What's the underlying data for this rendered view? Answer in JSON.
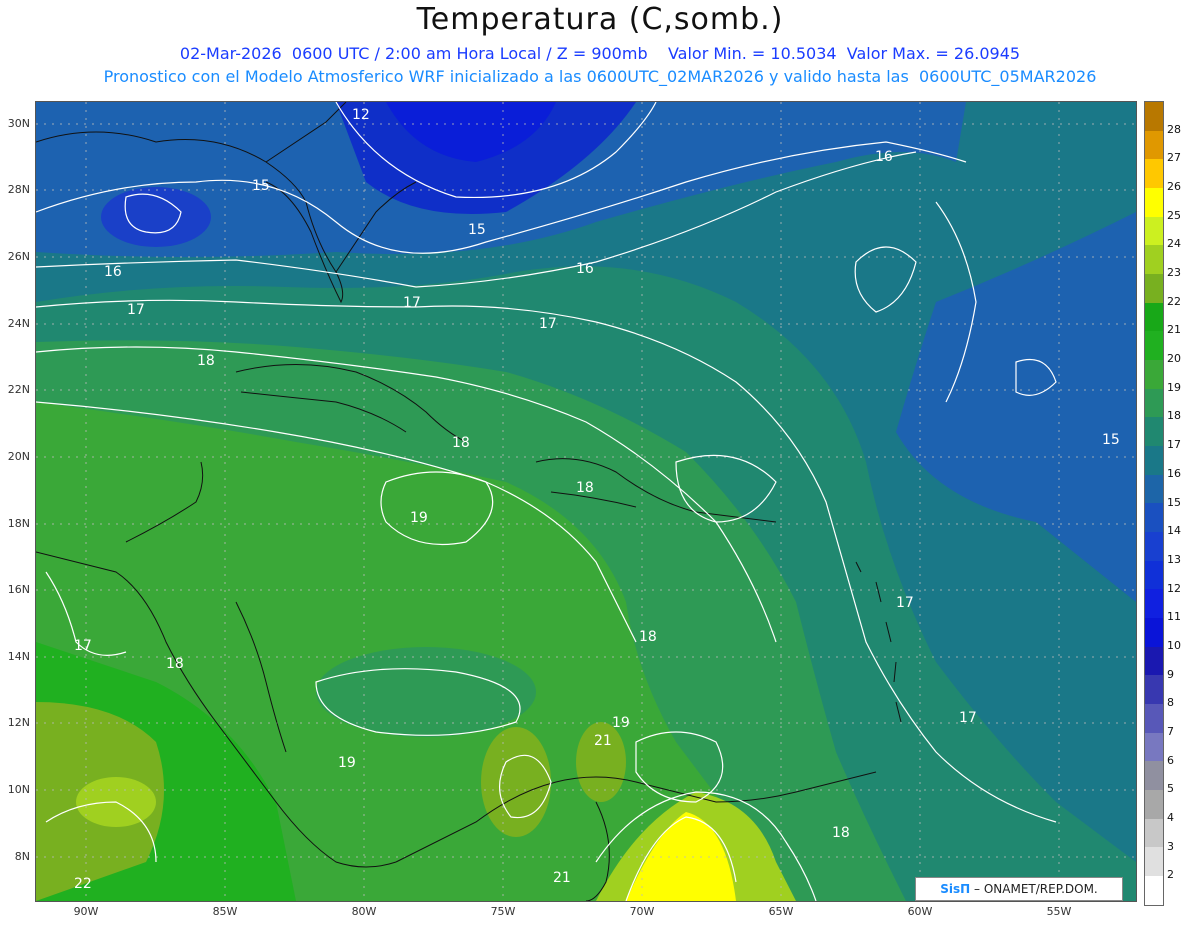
{
  "header": {
    "title": "Temperatura (C,somb.)",
    "line1": "02-Mar-2026  0600 UTC / 2:00 am Hora Local / Z = 900mb    Valor Min. = 10.5034  Valor Max. = 26.0945",
    "line2": "Pronostico con el Modelo Atmosferico WRF inicializado a las 0600UTC_02MAR2026 y valido hasta las  0600UTC_05MAR2026"
  },
  "map": {
    "lat_labels": [
      "30N",
      "28N",
      "26N",
      "24N",
      "22N",
      "20N",
      "18N",
      "16N",
      "14N",
      "12N",
      "10N",
      "8N"
    ],
    "lon_labels": [
      "90W",
      "85W",
      "80W",
      "75W",
      "70W",
      "65W",
      "60W",
      "55W"
    ],
    "contour_labels": [
      "12",
      "15",
      "15",
      "16",
      "16",
      "16",
      "17",
      "17",
      "17",
      "18",
      "18",
      "18",
      "18",
      "19",
      "19",
      "19",
      "21",
      "17",
      "17",
      "18",
      "17",
      "18",
      "22",
      "21",
      "15"
    ],
    "credit_brand": "SisΠ",
    "credit_text": "– ONAMET/REP.DOM."
  },
  "colorbar": {
    "labels": [
      "28",
      "27",
      "26",
      "25",
      "24",
      "23",
      "22",
      "21",
      "20",
      "19",
      "18",
      "17",
      "16",
      "15",
      "14",
      "13",
      "12",
      "11",
      "10",
      "9",
      "8",
      "7",
      "6",
      "5",
      "4",
      "3",
      "2"
    ],
    "colors": [
      "#b87800",
      "#e09800",
      "#ffc800",
      "#ffff00",
      "#ccf020",
      "#a0d020",
      "#78b020",
      "#18a818",
      "#20b020",
      "#3aa838",
      "#2e9a55",
      "#208870",
      "#1a7888",
      "#1d65a8",
      "#1a50c0",
      "#1840d0",
      "#1030d8",
      "#1020e0",
      "#0a14d8",
      "#1a18b0",
      "#3838b0",
      "#5858b8",
      "#7878c0",
      "#9090a0",
      "#a8a8a8",
      "#c8c8c8",
      "#e0e0e0",
      "#ffffff"
    ]
  }
}
